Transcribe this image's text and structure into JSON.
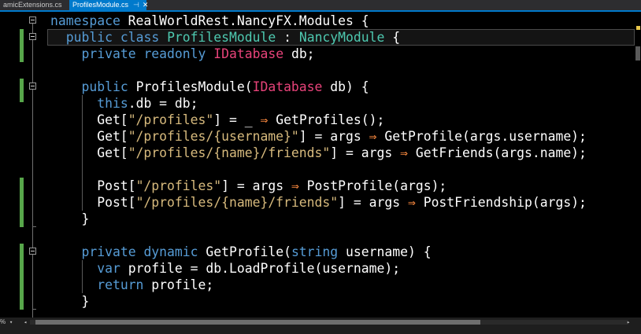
{
  "tabs": [
    {
      "label": "amicExtensions.cs",
      "active": false
    },
    {
      "label": "ProfilesModule.cs",
      "active": true,
      "pin_icon": "pin-icon",
      "close_icon": "close-icon"
    }
  ],
  "colors": {
    "tab_active": "#007acc",
    "keyword": "#569cd6",
    "type": "#4ec9b0",
    "interface_type": "#e8437a",
    "string": "#d7ba7d",
    "operator": "#ff8c40",
    "change_bar": "#57a64a"
  },
  "code": [
    {
      "name": "line-namespace",
      "tokens": [
        {
          "t": "namespace",
          "c": "kw"
        },
        {
          "t": " RealWorldRest.NancyFX.Modules {"
        }
      ]
    },
    {
      "name": "line-class",
      "tokens": [
        {
          "t": "  "
        },
        {
          "t": "public",
          "c": "kw"
        },
        {
          "t": " "
        },
        {
          "t": "class",
          "c": "kw"
        },
        {
          "t": " "
        },
        {
          "t": "ProfilesModule",
          "c": "ty"
        },
        {
          "t": " : "
        },
        {
          "t": "NancyModule",
          "c": "ty"
        },
        {
          "t": " {"
        }
      ]
    },
    {
      "name": "line-db-field",
      "tokens": [
        {
          "t": "    "
        },
        {
          "t": "private",
          "c": "kw"
        },
        {
          "t": " "
        },
        {
          "t": "readonly",
          "c": "kw"
        },
        {
          "t": " "
        },
        {
          "t": "IDatabase",
          "c": "ity"
        },
        {
          "t": " db;"
        }
      ]
    },
    {
      "name": "line-blank-1",
      "tokens": [
        {
          "t": ""
        }
      ]
    },
    {
      "name": "line-constructor",
      "tokens": [
        {
          "t": "    "
        },
        {
          "t": "public",
          "c": "kw"
        },
        {
          "t": " ProfilesModule("
        },
        {
          "t": "IDatabase",
          "c": "ity"
        },
        {
          "t": " db) {"
        }
      ]
    },
    {
      "name": "line-this-db",
      "tokens": [
        {
          "t": "      "
        },
        {
          "t": "this",
          "c": "kw"
        },
        {
          "t": ".db = db;"
        }
      ]
    },
    {
      "name": "line-get-profiles",
      "tokens": [
        {
          "t": "      Get["
        },
        {
          "t": "\"/profiles\"",
          "c": "str"
        },
        {
          "t": "] = _ "
        },
        {
          "t": "⇒",
          "c": "op"
        },
        {
          "t": " GetProfiles();"
        }
      ]
    },
    {
      "name": "line-get-profile",
      "tokens": [
        {
          "t": "      Get["
        },
        {
          "t": "\"/profiles/{username}\"",
          "c": "str"
        },
        {
          "t": "] = args "
        },
        {
          "t": "⇒",
          "c": "op"
        },
        {
          "t": " GetProfile(args.username);"
        }
      ]
    },
    {
      "name": "line-get-friends",
      "tokens": [
        {
          "t": "      Get["
        },
        {
          "t": "\"/profiles/{name}/friends\"",
          "c": "str"
        },
        {
          "t": "] = args "
        },
        {
          "t": "⇒",
          "c": "op"
        },
        {
          "t": " GetFriends(args.name);"
        }
      ]
    },
    {
      "name": "line-blank-2",
      "tokens": [
        {
          "t": ""
        }
      ]
    },
    {
      "name": "line-post-profile",
      "tokens": [
        {
          "t": "      Post["
        },
        {
          "t": "\"/profiles\"",
          "c": "str"
        },
        {
          "t": "] = args "
        },
        {
          "t": "⇒",
          "c": "op"
        },
        {
          "t": " PostProfile(args);"
        }
      ]
    },
    {
      "name": "line-post-friendship",
      "tokens": [
        {
          "t": "      Post["
        },
        {
          "t": "\"/profiles/{name}/friends\"",
          "c": "str"
        },
        {
          "t": "] = args "
        },
        {
          "t": "⇒",
          "c": "op"
        },
        {
          "t": " PostFriendship(args);"
        }
      ]
    },
    {
      "name": "line-close-constructor",
      "tokens": [
        {
          "t": "    }"
        }
      ]
    },
    {
      "name": "line-blank-3",
      "tokens": [
        {
          "t": ""
        }
      ]
    },
    {
      "name": "line-get-profile-method",
      "tokens": [
        {
          "t": "    "
        },
        {
          "t": "private",
          "c": "kw"
        },
        {
          "t": " "
        },
        {
          "t": "dynamic",
          "c": "kw"
        },
        {
          "t": " GetProfile("
        },
        {
          "t": "string",
          "c": "kw"
        },
        {
          "t": " username) {"
        }
      ]
    },
    {
      "name": "line-var-profile",
      "tokens": [
        {
          "t": "      "
        },
        {
          "t": "var",
          "c": "kw"
        },
        {
          "t": " profile = db.LoadProfile(username);"
        }
      ]
    },
    {
      "name": "line-return",
      "tokens": [
        {
          "t": "      "
        },
        {
          "t": "return",
          "c": "kw"
        },
        {
          "t": " profile;"
        }
      ]
    },
    {
      "name": "line-close-method",
      "tokens": [
        {
          "t": "    }"
        }
      ]
    }
  ],
  "bottom_bar": {
    "zoom": "%",
    "zoom_dropdown": "▾",
    "scroll_left": "◂",
    "scroll_right": "▸"
  }
}
